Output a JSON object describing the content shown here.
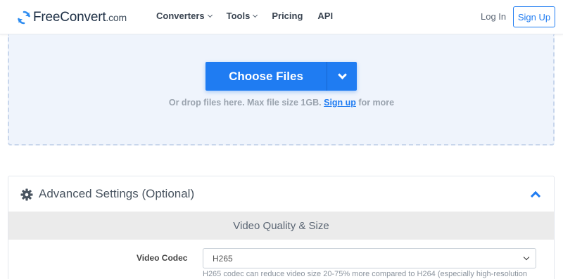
{
  "header": {
    "logo_main": "FreeConvert",
    "logo_suffix": ".com",
    "nav": [
      {
        "label": "Converters",
        "has_dropdown": true
      },
      {
        "label": "Tools",
        "has_dropdown": true
      },
      {
        "label": "Pricing",
        "has_dropdown": false
      },
      {
        "label": "API",
        "has_dropdown": false
      }
    ],
    "login_label": "Log In",
    "signup_label": "Sign Up"
  },
  "dropzone": {
    "choose_label": "Choose Files",
    "drop_text_before": "Or drop files here. Max file size 1GB.",
    "drop_link": "Sign up",
    "drop_text_after": "for more"
  },
  "advanced": {
    "title": "Advanced Settings (Optional)",
    "section_title": "Video Quality & Size",
    "codec_label": "Video Codec",
    "codec_value": "H265",
    "codec_hint": "H265 codec can reduce video size 20-75% more compared to H264 (especially high-resolution"
  },
  "colors": {
    "accent": "#1f7cf2",
    "dropzone_bg": "#eff4fc",
    "section_bar": "#ebebeb"
  },
  "icons": [
    "logo-refresh-icon",
    "chevron-down-icon",
    "gear-icon",
    "chevron-up-icon"
  ]
}
